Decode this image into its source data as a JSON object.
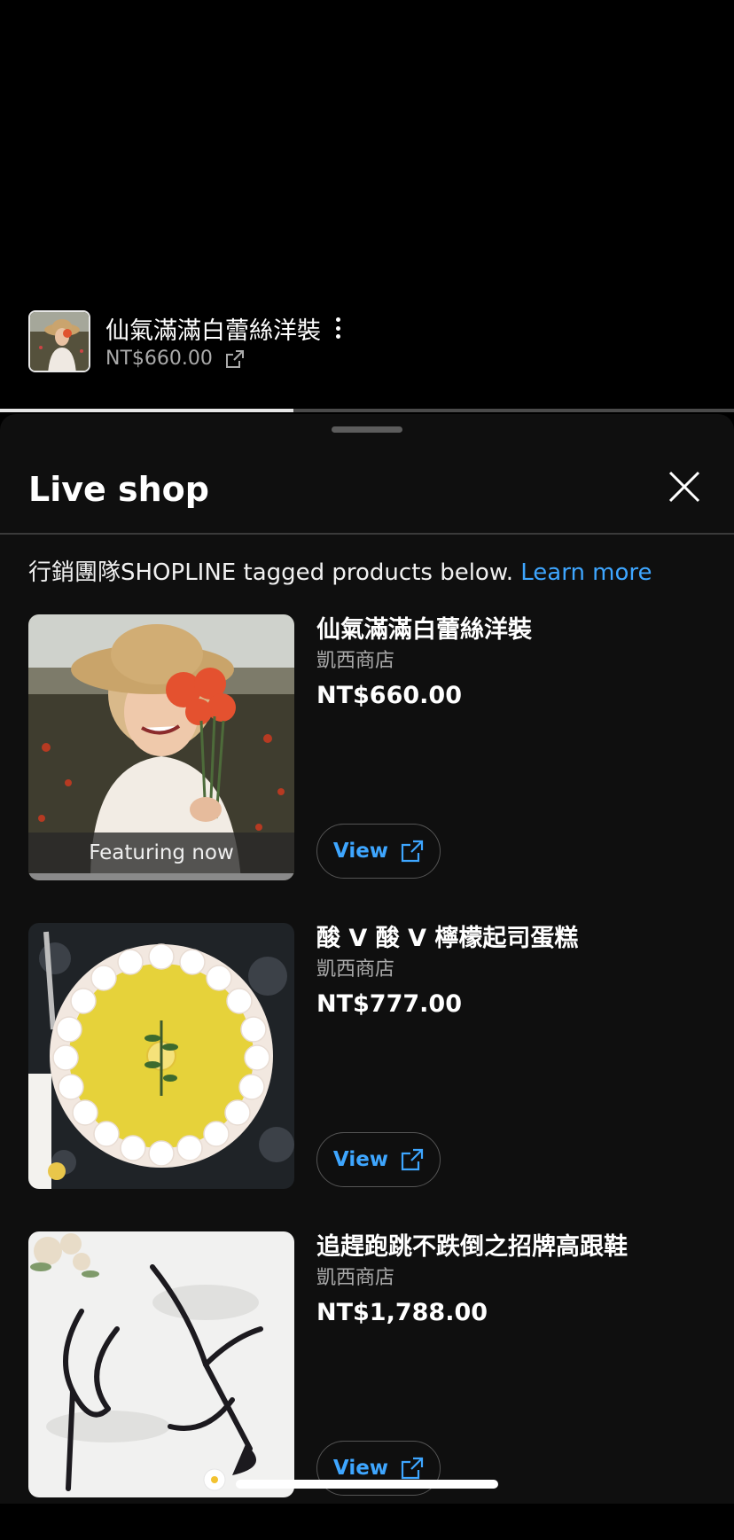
{
  "pinned": {
    "title": "仙氣滿滿白蕾絲洋裝",
    "price": "NT$660.00",
    "progress": 0.4
  },
  "sheet": {
    "title": "Live shop",
    "note_prefix": "行銷團隊SHOPLINE tagged products below.",
    "note_link": "Learn more"
  },
  "products": [
    {
      "name": "仙氣滿滿白蕾絲洋裝",
      "shop": "凱西商店",
      "price": "NT$660.00",
      "badge": "Featuring now",
      "view_label": "View"
    },
    {
      "name": "酸 V 酸 V 檸檬起司蛋糕",
      "shop": "凱西商店",
      "price": "NT$777.00",
      "view_label": "View"
    },
    {
      "name": "追趕跑跳不跌倒之招牌高跟鞋",
      "shop": "凱西商店",
      "price": "NT$1,788.00",
      "view_label": "View"
    }
  ],
  "colors": {
    "link": "#3ea6ff",
    "sheet_bg": "#0f0f0f",
    "muted_text": "#aaaaaa"
  },
  "icons": [
    "more-vert-icon",
    "external-link-icon",
    "close-icon"
  ]
}
